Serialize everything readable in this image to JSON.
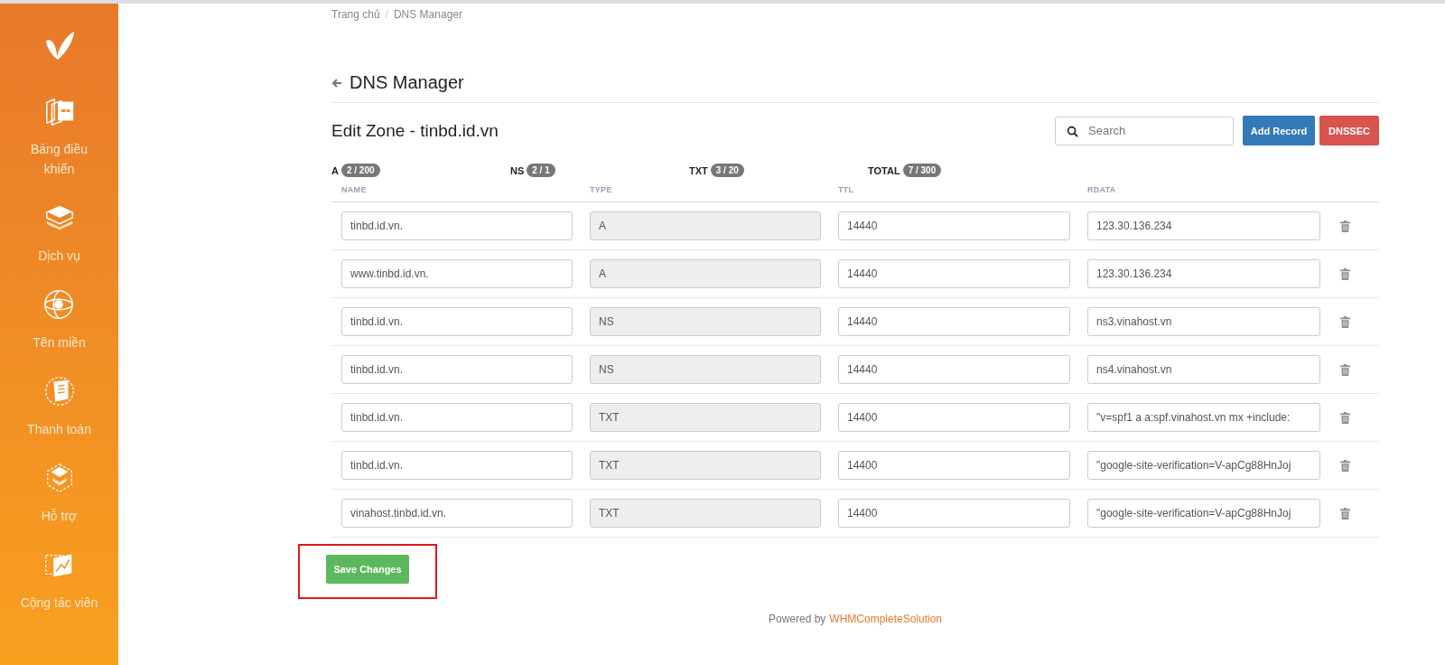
{
  "sidebar": {
    "items": [
      {
        "kind": "dashboard",
        "label": "Bảng điều khiển"
      },
      {
        "kind": "services",
        "label": "Dịch vụ"
      },
      {
        "kind": "domains",
        "label": "Tên miền"
      },
      {
        "kind": "billing",
        "label": "Thanh toán"
      },
      {
        "kind": "support",
        "label": "Hỗ trợ"
      },
      {
        "kind": "affiliate",
        "label": "Cộng tác viên"
      }
    ]
  },
  "breadcrumb": {
    "items": [
      "Trang chủ",
      "DNS Manager"
    ],
    "separator": "/"
  },
  "page_title": "DNS Manager",
  "zone_title": "Edit Zone - tinbd.id.vn",
  "search": {
    "placeholder": "Search"
  },
  "buttons": [
    {
      "kind": "primary",
      "label": "Add Record"
    },
    {
      "kind": "danger",
      "label": "DNSSEC"
    }
  ],
  "counts": [
    {
      "label": "A",
      "value": "2 / 200"
    },
    {
      "label": "NS",
      "value": "2 / 1"
    },
    {
      "label": "TXT",
      "value": "3 / 20"
    },
    {
      "label": "TOTAL",
      "value": "7 / 300"
    }
  ],
  "table": {
    "columns": [
      "NAME",
      "TYPE",
      "TTL",
      "RDATA"
    ],
    "rows": [
      {
        "name": "tinbd.id.vn.",
        "type": "A",
        "ttl": "14440",
        "rdata": "123.30.136.234"
      },
      {
        "name": "www.tinbd.id.vn.",
        "type": "A",
        "ttl": "14440",
        "rdata": "123.30.136.234"
      },
      {
        "name": "tinbd.id.vn.",
        "type": "NS",
        "ttl": "14440",
        "rdata": "ns3.vinahost.vn"
      },
      {
        "name": "tinbd.id.vn.",
        "type": "NS",
        "ttl": "14440",
        "rdata": "ns4.vinahost.vn"
      },
      {
        "name": "tinbd.id.vn.",
        "type": "TXT",
        "ttl": "14400",
        "rdata": "\"v=spf1 a a:spf.vinahost.vn mx +include:"
      },
      {
        "name": "tinbd.id.vn.",
        "type": "TXT",
        "ttl": "14400",
        "rdata": "\"google-site-verification=V-apCg88HnJoj"
      },
      {
        "name": "vinahost.tinbd.id.vn.",
        "type": "TXT",
        "ttl": "14400",
        "rdata": "\"google-site-verification=V-apCg88HnJoj"
      }
    ]
  },
  "save_button": {
    "label": "Save Changes",
    "highlighted": true
  },
  "footer": {
    "prefix": "Powered by",
    "link": "WHMCompleteSolution"
  }
}
